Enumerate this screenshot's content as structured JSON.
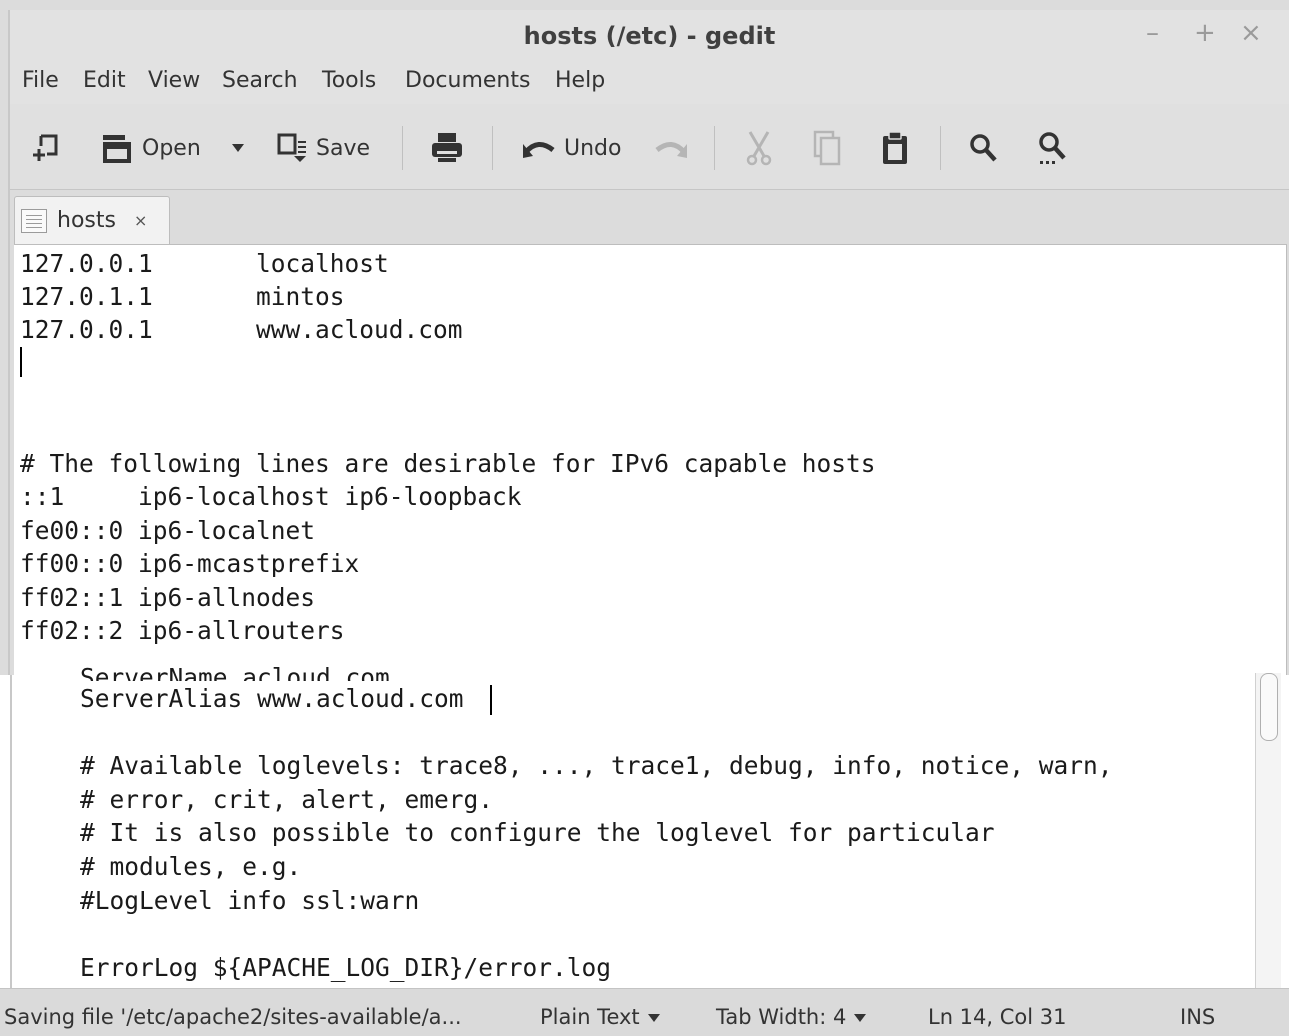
{
  "window": {
    "title": "hosts (/etc) - gedit",
    "controls": {
      "minimize": "–",
      "maximize": "+",
      "close": "×"
    }
  },
  "menubar": [
    "File",
    "Edit",
    "View",
    "Search",
    "Tools",
    "Documents",
    "Help"
  ],
  "toolbar": {
    "open_label": "Open",
    "save_label": "Save",
    "undo_label": "Undo",
    "icons": [
      "new-document-icon",
      "open-icon",
      "save-icon",
      "print-icon",
      "undo-icon",
      "redo-icon",
      "cut-icon",
      "copy-icon",
      "paste-icon",
      "search-icon",
      "replace-icon"
    ]
  },
  "tab": {
    "label": "hosts",
    "close": "×"
  },
  "hosts_editor": {
    "lines": [
      "127.0.0.1       localhost",
      "127.0.1.1       mintos",
      "127.0.0.1       www.acloud.com",
      "",
      "",
      "",
      "# The following lines are desirable for IPv6 capable hosts",
      "::1     ip6-localhost ip6-loopback",
      "fe00::0 ip6-localnet",
      "ff00::0 ip6-mcastprefix",
      "ff02::1 ip6-allnodes",
      "ff02::2 ip6-allrouters"
    ]
  },
  "apache_editor": {
    "partial_line": "ServerName acloud.com",
    "lines": [
      "ServerAlias www.acloud.com",
      "",
      "# Available loglevels: trace8, ..., trace1, debug, info, notice, warn,",
      "# error, crit, alert, emerg.",
      "# It is also possible to configure the loglevel for particular",
      "# modules, e.g.",
      "#LogLevel info ssl:warn",
      "",
      "ErrorLog ${APACHE_LOG_DIR}/error.log"
    ]
  },
  "statusbar": {
    "message": "Saving file '/etc/apache2/sites-available/a...",
    "language": "Plain Text",
    "tab_width": "Tab Width: 4",
    "position": "Ln 14, Col 31",
    "mode": "INS"
  }
}
